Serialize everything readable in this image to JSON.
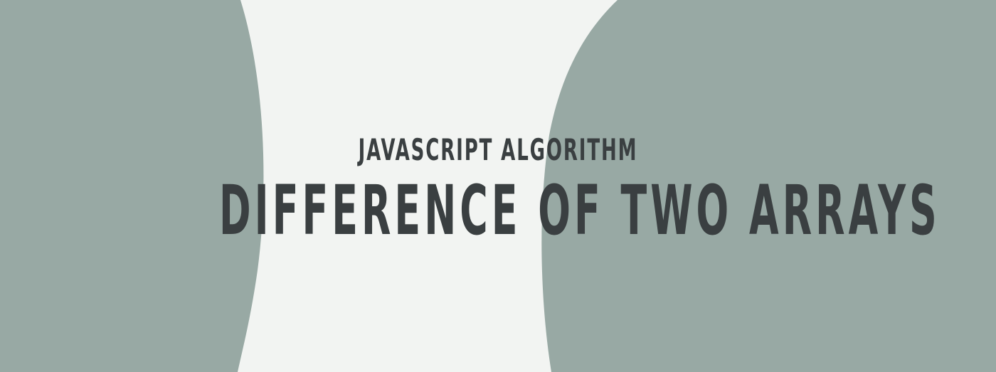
{
  "banner": {
    "kicker": "JAVASCRIPT ALGORITHM",
    "headline": "DIFFERENCE OF TWO ARRAYS"
  },
  "colors": {
    "background": "#f2f4f2",
    "shape_fill": "#98a9a4",
    "text": "#3a3f41"
  }
}
